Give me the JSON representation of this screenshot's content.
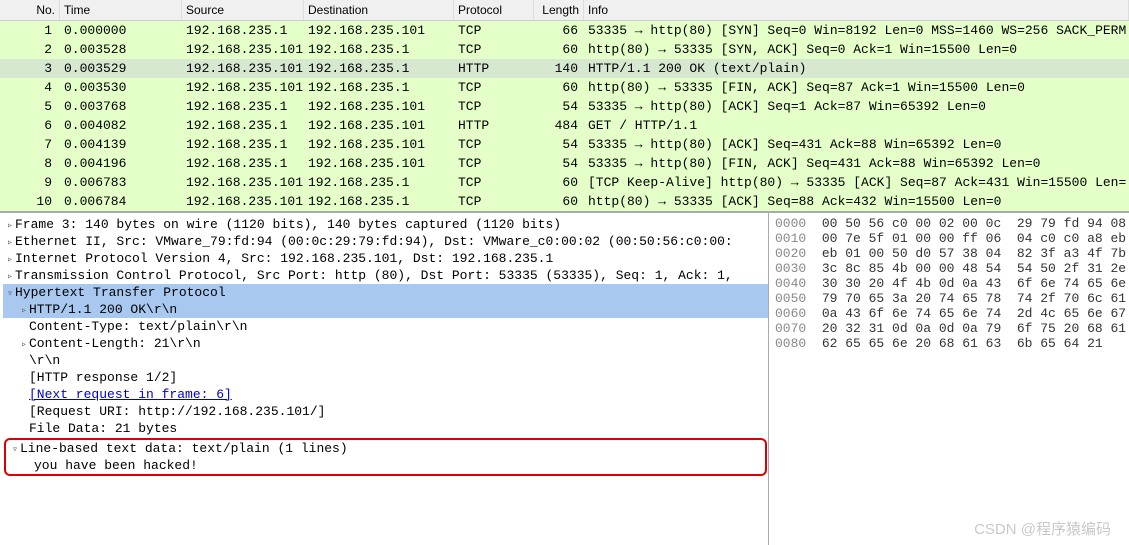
{
  "columns": {
    "no": "No.",
    "time": "Time",
    "src": "Source",
    "dst": "Destination",
    "proto": "Protocol",
    "len": "Length",
    "info": "Info"
  },
  "packets": [
    {
      "no": "1",
      "time": "0.000000",
      "src": "192.168.235.1",
      "dst": "192.168.235.101",
      "proto": "TCP",
      "len": "66",
      "info": "53335 → http(80) [SYN] Seq=0 Win=8192 Len=0 MSS=1460 WS=256 SACK_PERM"
    },
    {
      "no": "2",
      "time": "0.003528",
      "src": "192.168.235.101",
      "dst": "192.168.235.1",
      "proto": "TCP",
      "len": "60",
      "info": "http(80) → 53335 [SYN, ACK] Seq=0 Ack=1 Win=15500 Len=0"
    },
    {
      "no": "3",
      "time": "0.003529",
      "src": "192.168.235.101",
      "dst": "192.168.235.1",
      "proto": "HTTP",
      "len": "140",
      "info": "HTTP/1.1 200 OK  (text/plain)"
    },
    {
      "no": "4",
      "time": "0.003530",
      "src": "192.168.235.101",
      "dst": "192.168.235.1",
      "proto": "TCP",
      "len": "60",
      "info": "http(80) → 53335 [FIN, ACK] Seq=87 Ack=1 Win=15500 Len=0"
    },
    {
      "no": "5",
      "time": "0.003768",
      "src": "192.168.235.1",
      "dst": "192.168.235.101",
      "proto": "TCP",
      "len": "54",
      "info": "53335 → http(80) [ACK] Seq=1 Ack=87 Win=65392 Len=0"
    },
    {
      "no": "6",
      "time": "0.004082",
      "src": "192.168.235.1",
      "dst": "192.168.235.101",
      "proto": "HTTP",
      "len": "484",
      "info": "GET / HTTP/1.1"
    },
    {
      "no": "7",
      "time": "0.004139",
      "src": "192.168.235.1",
      "dst": "192.168.235.101",
      "proto": "TCP",
      "len": "54",
      "info": "53335 → http(80) [ACK] Seq=431 Ack=88 Win=65392 Len=0"
    },
    {
      "no": "8",
      "time": "0.004196",
      "src": "192.168.235.1",
      "dst": "192.168.235.101",
      "proto": "TCP",
      "len": "54",
      "info": "53335 → http(80) [FIN, ACK] Seq=431 Ack=88 Win=65392 Len=0"
    },
    {
      "no": "9",
      "time": "0.006783",
      "src": "192.168.235.101",
      "dst": "192.168.235.1",
      "proto": "TCP",
      "len": "60",
      "info": "[TCP Keep-Alive] http(80) → 53335 [ACK] Seq=87 Ack=431 Win=15500 Len="
    },
    {
      "no": "10",
      "time": "0.006784",
      "src": "192.168.235.101",
      "dst": "192.168.235.1",
      "proto": "TCP",
      "len": "60",
      "info": "http(80) → 53335 [ACK] Seq=88 Ack=432 Win=15500 Len=0"
    }
  ],
  "tree": {
    "frame": "Frame 3: 140 bytes on wire (1120 bits), 140 bytes captured (1120 bits)",
    "eth": "Ethernet II, Src: VMware_79:fd:94 (00:0c:29:79:fd:94), Dst: VMware_c0:00:02 (00:50:56:c0:00:",
    "ip": "Internet Protocol Version 4, Src: 192.168.235.101, Dst: 192.168.235.1",
    "tcp": "Transmission Control Protocol, Src Port: http (80), Dst Port: 53335 (53335), Seq: 1, Ack: 1,",
    "http": "Hypertext Transfer Protocol",
    "status": "HTTP/1.1 200 OK\\r\\n",
    "ctype": "Content-Type: text/plain\\r\\n",
    "clen": "Content-Length: 21\\r\\n",
    "crlf": "\\r\\n",
    "resp": "[HTTP response 1/2]",
    "next": "[Next request in frame: 6]",
    "uri": "[Request URI: http://192.168.235.101/]",
    "fdata": "File Data: 21 bytes",
    "lbtd": "Line-based text data: text/plain (1 lines)",
    "body": "you have been hacked!"
  },
  "hex": [
    {
      "off": "0000",
      "b": "00 50 56 c0 00 02 00 0c  29 79 fd 94 08"
    },
    {
      "off": "0010",
      "b": "00 7e 5f 01 00 00 ff 06  04 c0 c0 a8 eb"
    },
    {
      "off": "0020",
      "b": "eb 01 00 50 d0 57 38 04  82 3f a3 4f 7b"
    },
    {
      "off": "0030",
      "b": "3c 8c 85 4b 00 00 48 54  54 50 2f 31 2e"
    },
    {
      "off": "0040",
      "b": "30 30 20 4f 4b 0d 0a 43  6f 6e 74 65 6e"
    },
    {
      "off": "0050",
      "b": "79 70 65 3a 20 74 65 78  74 2f 70 6c 61"
    },
    {
      "off": "0060",
      "b": "0a 43 6f 6e 74 65 6e 74  2d 4c 65 6e 67"
    },
    {
      "off": "0070",
      "b": "20 32 31 0d 0a 0d 0a 79  6f 75 20 68 61"
    },
    {
      "off": "0080",
      "b": "62 65 65 6e 20 68 61 63  6b 65 64 21"
    }
  ],
  "watermark": "CSDN @程序猿编码"
}
